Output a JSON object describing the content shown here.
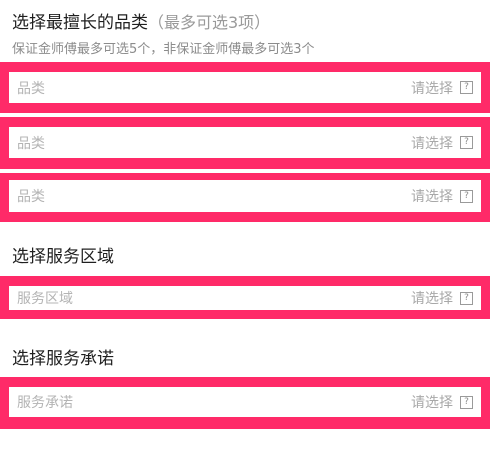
{
  "specialty": {
    "title": "选择最擅长的品类",
    "note": "（最多可选3项）",
    "subtitle": "保证金师傅最多可选5个，非保证金师傅最多可选3个",
    "fields": [
      {
        "label": "品类",
        "placeholder": "请选择"
      },
      {
        "label": "品类",
        "placeholder": "请选择"
      },
      {
        "label": "品类",
        "placeholder": "请选择"
      }
    ]
  },
  "area": {
    "title": "选择服务区域",
    "field": {
      "label": "服务区域",
      "placeholder": "请选择"
    }
  },
  "promise": {
    "title": "选择服务承诺",
    "field": {
      "label": "服务承诺",
      "placeholder": "请选择"
    }
  },
  "icons": {
    "dropdown": "question-box-icon",
    "glyph": "?"
  },
  "colors": {
    "accent": "#ff2a68"
  }
}
